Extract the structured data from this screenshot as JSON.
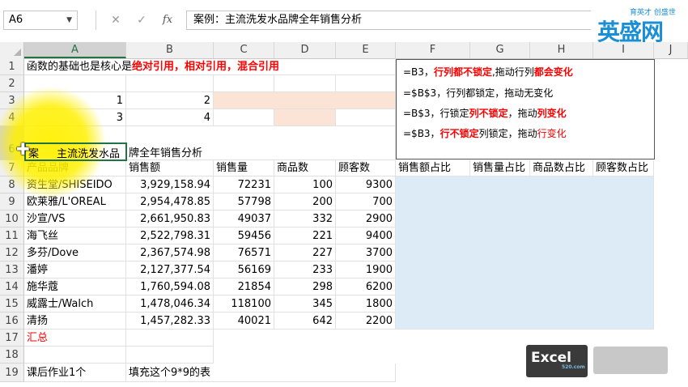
{
  "formula_bar": {
    "name_box": "A6",
    "cancel_icon": "✕",
    "enter_icon": "✓",
    "fx_label": "fx",
    "formula": "案例：主流洗发水品牌全年销售分析"
  },
  "logo": {
    "main": "英盛网",
    "sub": "育英才 创盛世"
  },
  "columns": [
    "A",
    "B",
    "C",
    "D",
    "E",
    "F",
    "G",
    "H",
    "I",
    "J"
  ],
  "rows": [
    "1",
    "2",
    "3",
    "4",
    "6",
    "7",
    "8",
    "9",
    "10",
    "11",
    "12",
    "13",
    "14",
    "15",
    "16",
    "17",
    "18",
    "19"
  ],
  "cells": {
    "A1_prefix": "函数的基础也是核心是",
    "A1_red": "绝对引用，相对引用，混合引用",
    "A3": "1",
    "B3": "2",
    "A4": "3",
    "B4": "4",
    "A6_left": "案",
    "A6_right": "主流洗发水品",
    "B6": "牌全年销售分析",
    "A16": "汇总",
    "A18": "课后作业1个",
    "B18": "填充这个9*9的表"
  },
  "headers": [
    "产品品牌",
    "销售额",
    "销售量",
    "商品数",
    "顾客数",
    "销售额占比",
    "销售量占比",
    "商品数占比",
    "顾客数占比"
  ],
  "table_rows": [
    {
      "row": "8",
      "brand": "资生堂/SHISEIDO",
      "sales": "3,929,158.94",
      "qty": "72231",
      "items": "100",
      "customers": "9300"
    },
    {
      "row": "9",
      "brand": "欧莱雅/L'OREAL",
      "sales": "2,954,478.85",
      "qty": "57798",
      "items": "200",
      "customers": "700"
    },
    {
      "row": "10",
      "brand": "沙宣/VS",
      "sales": "2,661,950.83",
      "qty": "49037",
      "items": "332",
      "customers": "2900"
    },
    {
      "row": "11",
      "brand": "海飞丝",
      "sales": "2,522,798.31",
      "qty": "59456",
      "items": "221",
      "customers": "9400"
    },
    {
      "row": "12",
      "brand": "多芬/Dove",
      "sales": "2,367,574.98",
      "qty": "76571",
      "items": "227",
      "customers": "3700"
    },
    {
      "row": "13",
      "brand": "潘婷",
      "sales": "2,127,377.54",
      "qty": "56169",
      "items": "233",
      "customers": "1900"
    },
    {
      "row": "14",
      "brand": "施华蔻",
      "sales": "1,760,594.08",
      "qty": "21854",
      "items": "298",
      "customers": "6200"
    },
    {
      "row": "15",
      "brand": "威露士/Walch",
      "sales": "1,478,046.34",
      "qty": "118100",
      "items": "345",
      "customers": "1800"
    },
    {
      "row": "16",
      "brand": "清扬",
      "sales": "1,457,282.33",
      "qty": "40021",
      "items": "642",
      "customers": "2200"
    }
  ],
  "note": {
    "l1_a": "=B3，",
    "l1_b": "行列都不锁定",
    "l1_c": ",拖动行列",
    "l1_d": "都会变化",
    "l2": "=$B$3，行列都锁定，拖动无变化",
    "l3_a": "=B$3，行锁定",
    "l3_b": "列不锁定",
    "l3_c": "，拖动",
    "l3_d": "列变化",
    "l4_a": "=$B3，",
    "l4_b": "行不锁定",
    "l4_c": "列锁定，拖动",
    "l4_d": "行变化"
  },
  "watermark": {
    "excel": "Excel",
    "small": "520.com"
  }
}
